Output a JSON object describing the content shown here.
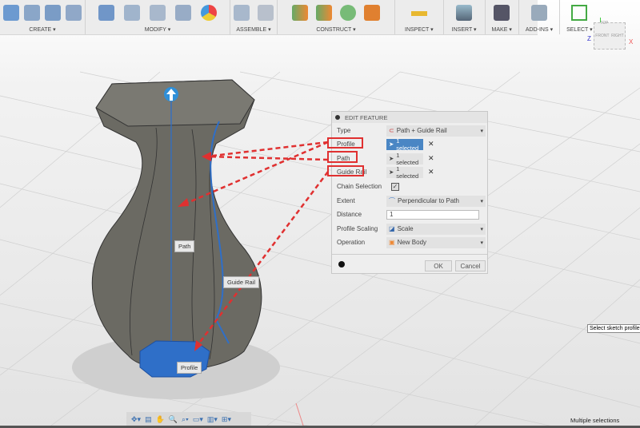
{
  "toolbar": {
    "groups": [
      {
        "label": "CREATE ▾",
        "icons": [
          "extrude-icon",
          "revolve-icon",
          "sweep-icon",
          "loft-icon"
        ]
      },
      {
        "label": "MODIFY ▾",
        "icons": [
          "press-pull-icon",
          "fillet-icon",
          "chamfer-icon",
          "shell-icon",
          "appearance-icon"
        ]
      },
      {
        "label": "ASSEMBLE ▾",
        "icons": [
          "new-component-icon",
          "joint-icon"
        ]
      },
      {
        "label": "CONSTRUCT ▾",
        "icons": [
          "offset-plane-icon",
          "midplane-icon",
          "axis-icon",
          "plane-at-angle-icon"
        ]
      },
      {
        "label": "INSPECT ▾",
        "icons": [
          "measure-icon"
        ]
      },
      {
        "label": "INSERT ▾",
        "icons": [
          "insert-image-icon"
        ]
      },
      {
        "label": "MAKE ▾",
        "icons": [
          "3d-print-icon"
        ]
      },
      {
        "label": "ADD-INS ▾",
        "icons": [
          "scripts-icon"
        ]
      },
      {
        "label": "SELECT ▾",
        "icons": [
          "select-icon"
        ]
      }
    ]
  },
  "viewcube": {
    "top": "TOP",
    "front": "FRONT",
    "right": "RIGHT",
    "x": "X",
    "z": "Z"
  },
  "panel": {
    "title": "EDIT FEATURE",
    "type_label": "Type",
    "type_value": "Path + Guide Rail",
    "profile_label": "Profile",
    "profile_value": "1 selected",
    "path_label": "Path",
    "path_value": "1 selected",
    "guide_label": "Guide Rail",
    "guide_value": "1 selected",
    "chain_label": "Chain Selection",
    "chain_checked": true,
    "extent_label": "Extent",
    "extent_value": "Perpendicular to Path",
    "distance_label": "Distance",
    "distance_value": "1",
    "scaling_label": "Profile Scaling",
    "scaling_value": "Scale",
    "operation_label": "Operation",
    "operation_value": "New Body",
    "ok": "OK",
    "cancel": "Cancel",
    "clear": "✕"
  },
  "canvas_labels": {
    "path": "Path",
    "guide_rail": "Guide Rail",
    "profile": "Profile"
  },
  "tooltip": "Select sketch profile",
  "status": "Multiple selections",
  "colors": {
    "annotation": "#e03030",
    "selection": "#2f6fc8",
    "body": "#6b6a63"
  }
}
